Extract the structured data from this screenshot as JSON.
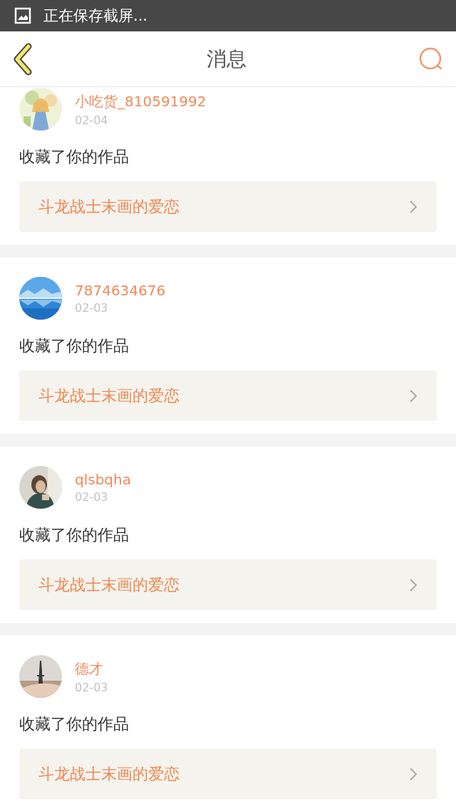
{
  "status_bar": {
    "notification": "正在保存截屏..."
  },
  "header": {
    "title": "消息"
  },
  "messages": [
    {
      "user": "小吃货_810591992",
      "date": "02-04",
      "action": "收藏了你的作品",
      "work": "斗龙战士末画的爱恋"
    },
    {
      "user": "7874634676",
      "date": "02-03",
      "action": "收藏了你的作品",
      "work": "斗龙战士末画的爱恋"
    },
    {
      "user": "qlsbqha",
      "date": "02-03",
      "action": "收藏了你的作品",
      "work": "斗龙战士末画的爱恋"
    },
    {
      "user": "德才",
      "date": "02-03",
      "action": "收藏了你的作品",
      "work": "斗龙战士末画的爱恋"
    }
  ]
}
